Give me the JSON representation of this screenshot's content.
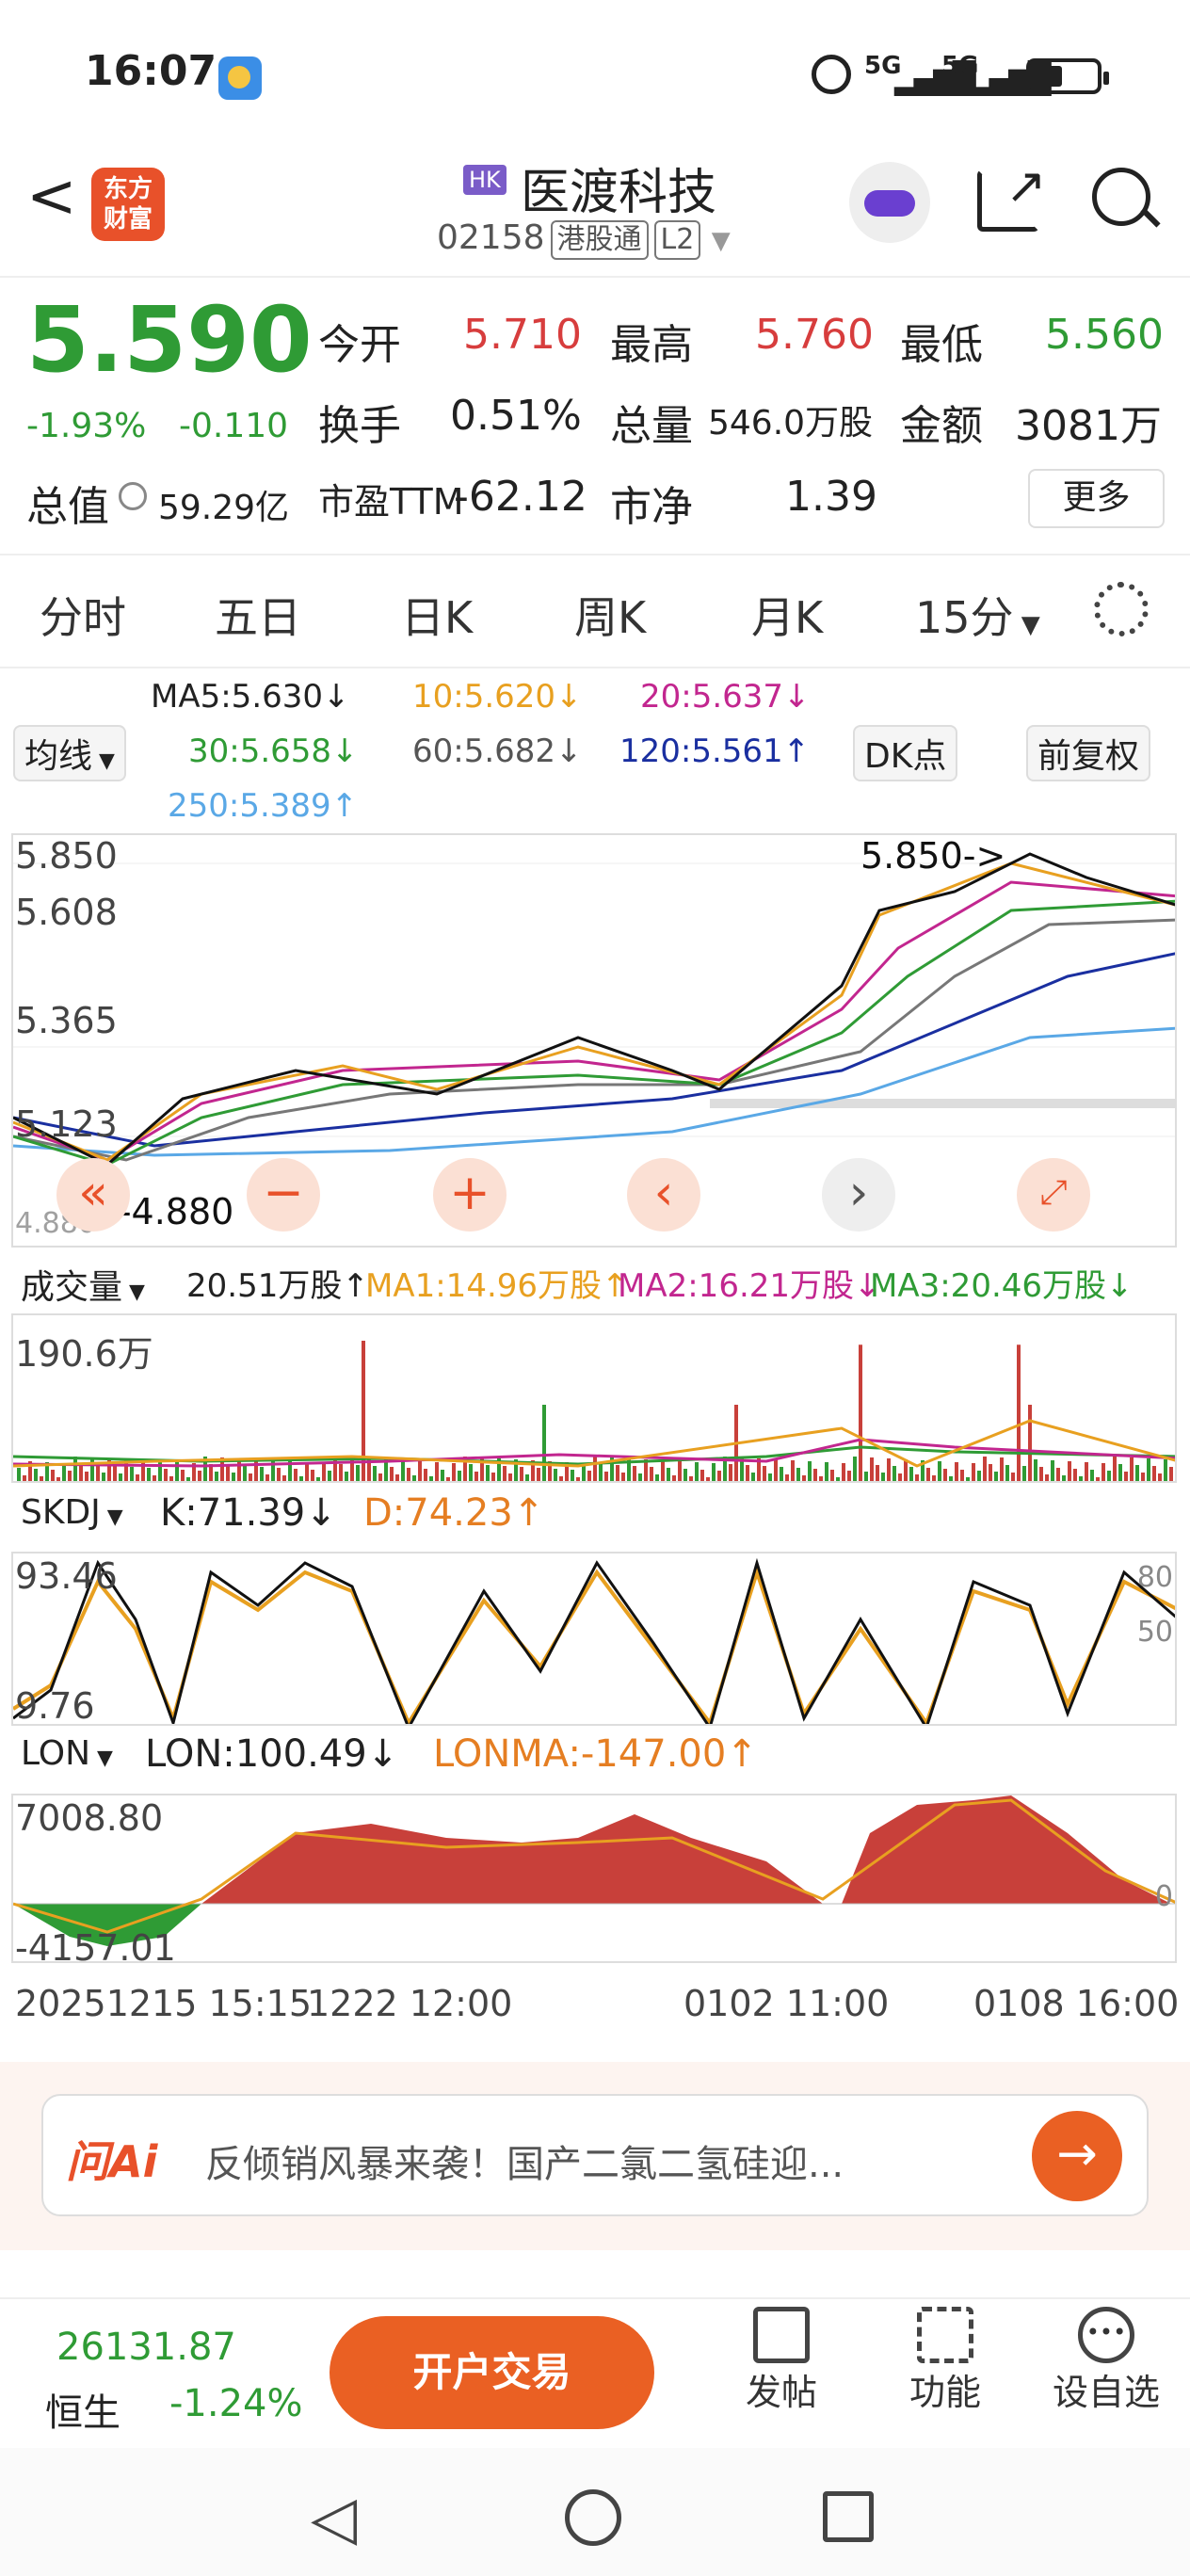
{
  "status": {
    "time": "16:07",
    "net1": "5G",
    "net2": "5G"
  },
  "header": {
    "back": "<",
    "app_logo": "东方\n财富",
    "market_badge": "HK",
    "stock_name": "医渡科技",
    "stock_code": "02158",
    "tag1": "港股通",
    "tag2": "L2"
  },
  "quote": {
    "price": "5.590",
    "change_pct": "-1.93%",
    "change": "-0.110",
    "open_label": "今开",
    "open": "5.710",
    "high_label": "最高",
    "high": "5.760",
    "low_label": "最低",
    "low": "5.560",
    "turnover_label": "换手",
    "turnover": "0.51%",
    "volume_label": "总量",
    "volume": "546.0万股",
    "amount_label": "金额",
    "amount": "3081万",
    "mktcap_label": "总值",
    "mktcap": "59.29亿",
    "pe_label": "市盈TTM",
    "pe": "-62.12",
    "pb_label": "市净",
    "pb": "1.39",
    "more": "更多"
  },
  "tabs": [
    "分时",
    "五日",
    "日K",
    "周K",
    "月K",
    "15分"
  ],
  "ma": {
    "ma5": "MA5:5.630↓",
    "ma10": "10:5.620↓",
    "ma20": "20:5.637↓",
    "ma30": "30:5.658↓",
    "ma60": "60:5.682↓",
    "ma120": "120:5.561↑",
    "ma250": "250:5.389↑",
    "select": "均线",
    "dk": "DK点",
    "fq": "前复权"
  },
  "kchart": {
    "y_labels": [
      "5.850",
      "5.608",
      "5.365",
      "5.123"
    ],
    "max_note": "5.850->",
    "min_note": "<-4.880",
    "low_tick": "4.880"
  },
  "vol": {
    "select": "成交量",
    "v": "20.51万股↑",
    "ma1": "MA1:14.96万股↑",
    "ma2": "MA2:16.21万股↓",
    "ma3": "MA3:20.46万股↓",
    "ymax": "190.6万"
  },
  "skdj": {
    "select": "SKDJ",
    "k": "K:71.39↓",
    "d": "D:74.23↑",
    "ymax": "93.46",
    "ymin": "9.76",
    "r1": "80",
    "r2": "50"
  },
  "lon": {
    "select": "LON",
    "lon": "LON:100.49↓",
    "lonma": "LONMA:-147.00↑",
    "ymax": "7008.80",
    "ymin": "-4157.01",
    "zero": "0"
  },
  "xaxis": [
    "20251215 15:15",
    "1222 12:00",
    "0102 11:00",
    "0108 16:00"
  ],
  "ai": {
    "logo": "问Ai",
    "text": "反倾销风暴来袭！国产二氯二氢硅迎..."
  },
  "bottom": {
    "index_value": "26131.87",
    "index_name": "恒生",
    "index_change": "-1.24%",
    "trade": "开户交易",
    "post": "发帖",
    "func": "功能",
    "watch": "设自选"
  },
  "colors": {
    "up": "#d73d3d",
    "down": "#2f9b35",
    "accent": "#ea6023"
  }
}
